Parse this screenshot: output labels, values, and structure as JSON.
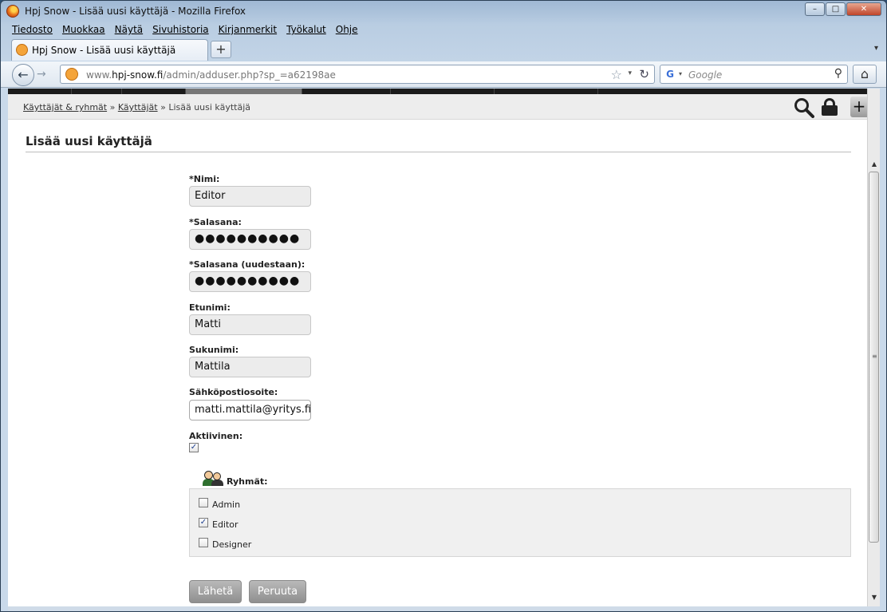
{
  "window": {
    "title": "Hpj Snow - Lisää uusi käyttäjä - Mozilla Firefox",
    "minimize": "–",
    "maximize": "□",
    "close": "✕"
  },
  "menu": [
    "Tiedosto",
    "Muokkaa",
    "Näytä",
    "Sivuhistoria",
    "Kirjanmerkit",
    "Työkalut",
    "Ohje"
  ],
  "tab": {
    "label": "Hpj Snow - Lisää uusi käyttäjä",
    "new_tab": "+"
  },
  "nav": {
    "url_host_prefix": "www.",
    "url_host": "hpj-snow.fi",
    "url_path": "/admin/adduser.php?sp_=a62198ae",
    "search_placeholder": "Google"
  },
  "page": {
    "breadcrumb": {
      "crumb1": "Käyttäjät & ryhmät",
      "sep": " » ",
      "crumb2": "Käyttäjät",
      "current": "Lisää uusi käyttäjä"
    },
    "title": "Lisää uusi käyttäjä",
    "fields": {
      "name_label": "*Nimi:",
      "name_value": "Editor",
      "password_label": "*Salasana:",
      "password_value": "●●●●●●●●●●",
      "password2_label": "*Salasana (uudestaan):",
      "password2_value": "●●●●●●●●●●",
      "firstname_label": "Etunimi:",
      "firstname_value": "Matti",
      "lastname_label": "Sukunimi:",
      "lastname_value": "Mattila",
      "email_label": "Sähköpostiosoite:",
      "email_value": "matti.mattila@yritys.fi",
      "active_label": "Aktiivinen:",
      "active_checked": true
    },
    "groups": {
      "label": "Ryhmät:",
      "items": [
        {
          "label": "Admin",
          "checked": false
        },
        {
          "label": "Editor",
          "checked": true
        },
        {
          "label": "Designer",
          "checked": false
        }
      ]
    },
    "buttons": {
      "submit": "Lähetä",
      "cancel": "Peruuta"
    }
  },
  "icons": {
    "back": "←",
    "forward": "→",
    "star": "☆",
    "reload": "↻",
    "home": "⌂",
    "search": "🔍",
    "check": "✓",
    "add": "+",
    "dropdown": "▾"
  }
}
